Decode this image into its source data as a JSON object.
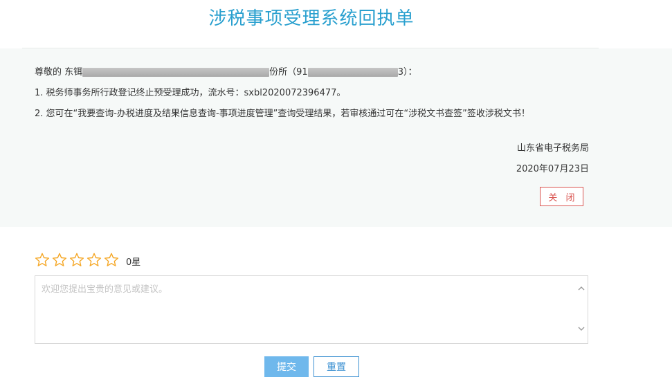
{
  "title": "涉税事项受理系统回执单",
  "message": {
    "greeting_prefix": "尊敬的 东铒",
    "greeting_mid": "份所（91",
    "greeting_tail": "3）：",
    "line1": "1. 税务师事务所行政登记终止预受理成功，流水号：sxbl2020072396477。",
    "line2": "2. 您可在“我要查询-办税进度及结果信息查询-事项进度管理”查询受理结果，若审核通过可在“涉税文书查签”签收涉税文书！"
  },
  "signature": {
    "org": "山东省电子税务局",
    "date": "2020年07月23日"
  },
  "close_label": "关 闭",
  "rating": {
    "stars_total": 5,
    "stars_selected": 0,
    "label": "0星",
    "star_color": "#f5a623"
  },
  "feedback": {
    "placeholder": "欢迎您提出宝贵的意见或建议。",
    "value": ""
  },
  "buttons": {
    "submit": "提交",
    "reset": "重置"
  }
}
